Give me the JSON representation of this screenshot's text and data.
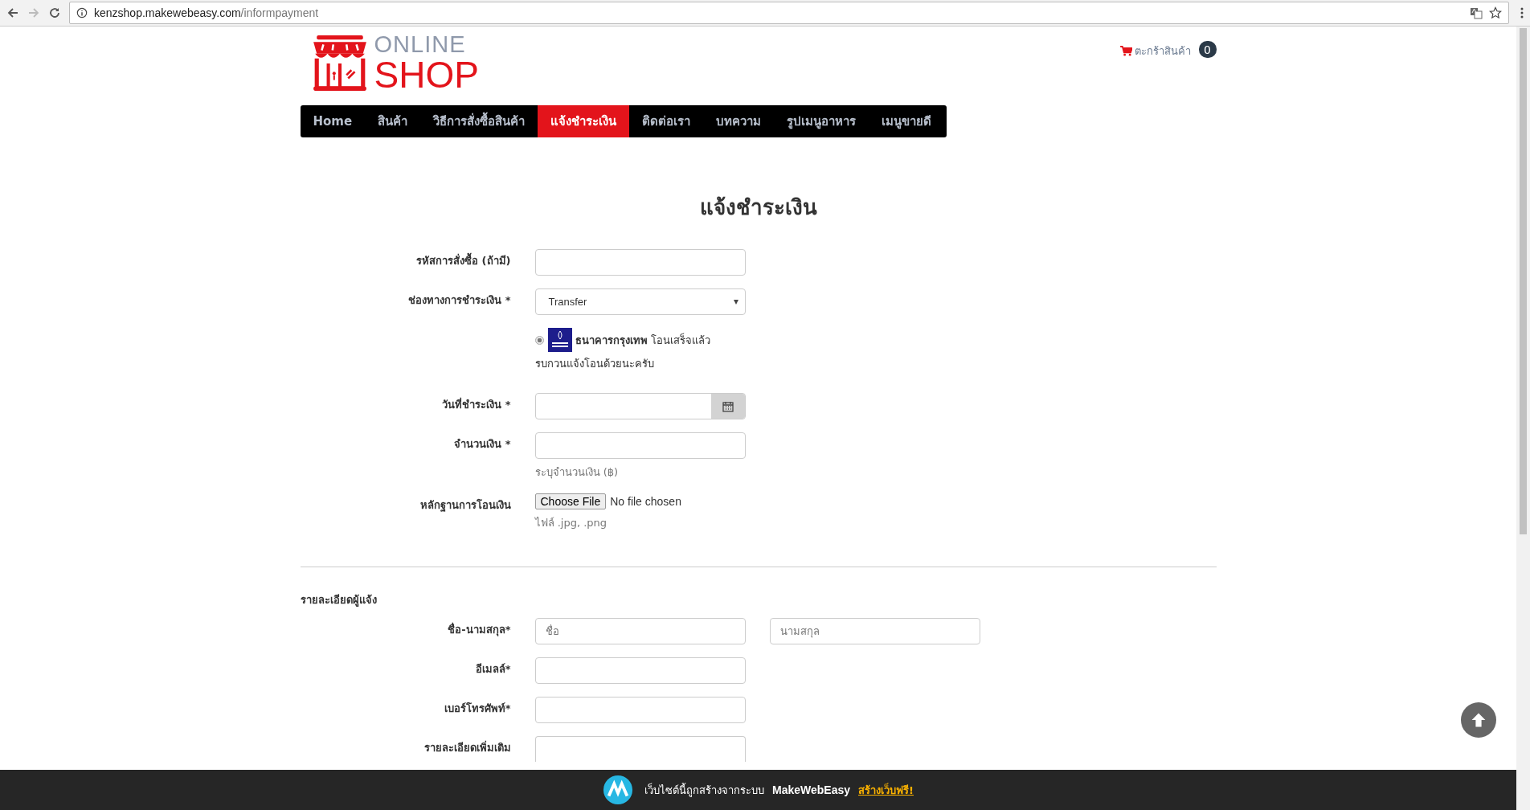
{
  "browser": {
    "url_host": "kenzshop.makewebeasy.com",
    "url_path": "/informpayment"
  },
  "header": {
    "logo": {
      "line1": "ONLINE",
      "line2": "SHOP"
    },
    "cart": {
      "label": "ตะกร้าสินค้า",
      "count": "0"
    }
  },
  "nav": [
    {
      "label": "Home",
      "selected": false
    },
    {
      "label": "สินค้า",
      "selected": false
    },
    {
      "label": "วิธีการสั่งซื้อสินค้า",
      "selected": false
    },
    {
      "label": "แจ้งชำระเงิน",
      "selected": true
    },
    {
      "label": "ติดต่อเรา",
      "selected": false
    },
    {
      "label": "บทความ",
      "selected": false
    },
    {
      "label": "รูปเมนูอาหาร",
      "selected": false
    },
    {
      "label": "เมนูขายดี",
      "selected": false
    }
  ],
  "title": "แจ้งชำระเงิน",
  "payment_fields": [
    {
      "kind": "text",
      "label": "รหัสการสั่งซื้อ (ถ้ามี)"
    },
    {
      "kind": "select",
      "label": "ช่องทางการชำระเงิน *",
      "value": "Transfer"
    },
    {
      "kind": "bank",
      "selected": true,
      "text": "**ธนาคารกรุงเทพ** โอนเสร็จแล้ว",
      "text_line2": "รบกวนแจ้งโอนด้วยนะครับ"
    },
    {
      "kind": "date",
      "label": "วันที่ชำระเงิน *"
    },
    {
      "kind": "text",
      "label": "จำนวนเงิน *",
      "help": "ระบุจำนวนเงิน (฿)"
    },
    {
      "kind": "file",
      "label": "หลักฐานการโอนเงิน",
      "button": "Choose File",
      "status": "No file chosen",
      "help": "ไฟล์ .jpg, .png"
    }
  ],
  "sender_section": {
    "title": "รายละเอียดผู้แจ้ง",
    "fields": [
      {
        "kind": "name",
        "label": "ชื่อ-นามสกุล*",
        "placeholder": "ชื่อ",
        "placeholder_2": "นามสกุล"
      },
      {
        "kind": "text",
        "label": "อีเมลล์*"
      },
      {
        "kind": "text",
        "label": "เบอร์โทรศัพท์*"
      },
      {
        "kind": "textarea",
        "label": "รายละเอียดเพิ่มเติม"
      }
    ]
  },
  "footer": {
    "text": "เว็บไซต์นี้ถูกสร้างจากระบบ",
    "brand": "MakeWebEasy",
    "link": "สร้างเว็บฟรี!"
  }
}
